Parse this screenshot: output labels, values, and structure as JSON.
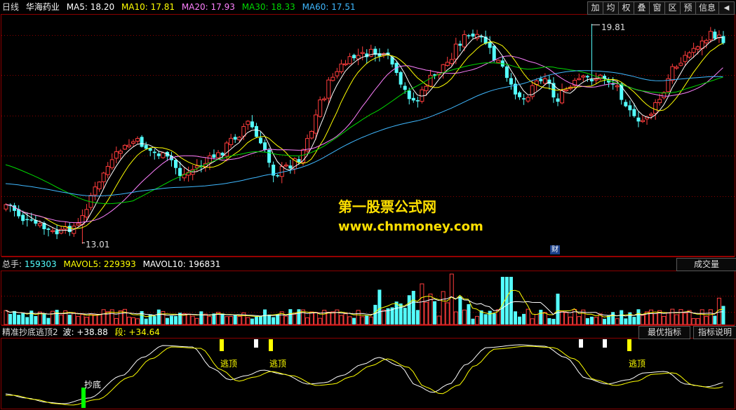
{
  "header": {
    "period": "日线",
    "stock": "华海药业",
    "ma5": "MA5: 18.20",
    "ma10": "MA10: 17.81",
    "ma20": "MA20: 17.93",
    "ma30": "MA30: 18.33",
    "ma60": "MA60: 17.51"
  },
  "toolbar": [
    "加",
    "均",
    "权",
    "叠",
    "窗",
    "区",
    "预",
    "信息",
    "◀"
  ],
  "main": {
    "high_label": "19.81",
    "low_label": "13.01",
    "fin_badge": "财"
  },
  "watermark": {
    "line1": "第一股票公式网",
    "line2": "www.chnmoney.com"
  },
  "volume": {
    "label": "总手:",
    "value": "159303",
    "mavol5": "MAVOL5: 229393",
    "mavol10": "MAVOL10: 196831",
    "selector": "成交量"
  },
  "indicator": {
    "name": "精准抄底逃顶2",
    "wave": "波: +38.88",
    "seg": "段: +34.64",
    "btn_best": "最优指标",
    "btn_help": "指标说明",
    "bottom_label": "抄底",
    "top_labels": [
      "逃顶",
      "逃顶",
      "逃顶"
    ]
  },
  "colors": {
    "up": "#ff3c3c",
    "down": "#54ffff",
    "ma5": "#ffffff",
    "ma10": "#ffff00",
    "ma20": "#ff80ff",
    "ma30": "#00d800",
    "ma60": "#3fb8ff",
    "grid": "#8b0000",
    "bottom_signal": "#00ff00",
    "top_signal": "#ffff00"
  },
  "chart_data": {
    "type": "candlestick",
    "title": "华海药业",
    "period": "日线",
    "high": 19.81,
    "low": 13.01,
    "series": [
      "MA5",
      "MA10",
      "MA20",
      "MA30",
      "MA60"
    ]
  }
}
